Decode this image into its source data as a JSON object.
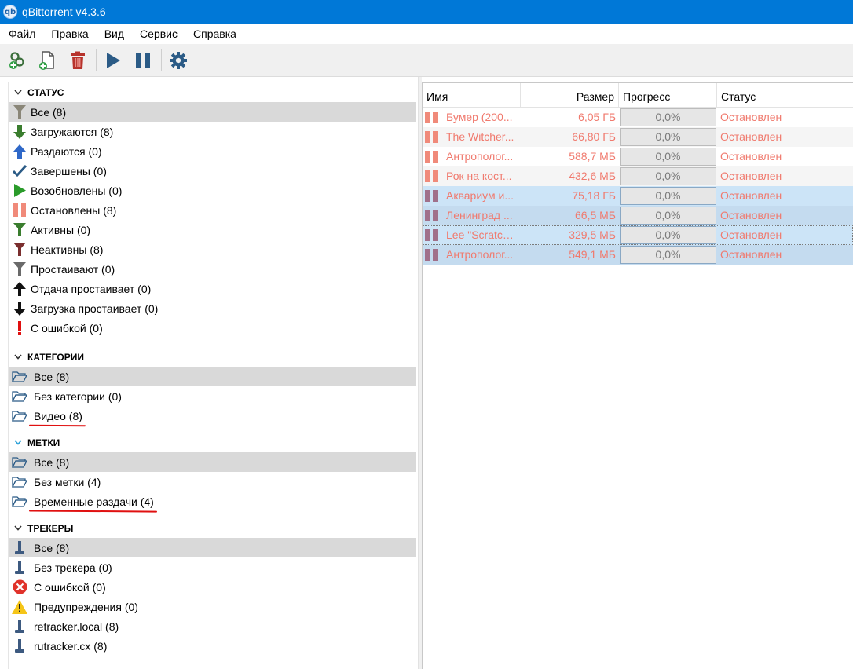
{
  "window": {
    "title": "qBittorrent v4.3.6",
    "icon_text": "qb"
  },
  "menu": [
    "Файл",
    "Правка",
    "Вид",
    "Сервис",
    "Справка"
  ],
  "toolbar": [
    "add-link-icon",
    "add-file-icon",
    "delete-icon",
    "resume-icon",
    "pause-icon",
    "settings-icon"
  ],
  "colors": {
    "titlebar": "#0078d7",
    "paused_text": "#f07a6e",
    "selected_row": "#cce4f7"
  },
  "sidebar": {
    "status": {
      "header": "СТАТУС",
      "items": [
        {
          "label": "Все (8)",
          "icon": "filter-icon"
        },
        {
          "label": "Загружаются (8)",
          "icon": "download-arrow-icon"
        },
        {
          "label": "Раздаются (0)",
          "icon": "upload-arrow-icon"
        },
        {
          "label": "Завершены (0)",
          "icon": "checkmark-icon"
        },
        {
          "label": "Возобновлены (0)",
          "icon": "play-icon"
        },
        {
          "label": "Остановлены (8)",
          "icon": "pause-icon"
        },
        {
          "label": "Активны (0)",
          "icon": "filter-green-icon"
        },
        {
          "label": "Неактивны (8)",
          "icon": "filter-red-icon"
        },
        {
          "label": "Простаивают (0)",
          "icon": "filter-gray-icon"
        },
        {
          "label": "Отдача простаивает (0)",
          "icon": "stalled-upload-icon"
        },
        {
          "label": "Загрузка простаивает (0)",
          "icon": "stalled-download-icon"
        },
        {
          "label": "С ошибкой (0)",
          "icon": "error-exclamation-icon"
        }
      ]
    },
    "categories": {
      "header": "КАТЕГОРИИ",
      "items": [
        {
          "label": "Все (8)"
        },
        {
          "label": "Без категории (0)"
        },
        {
          "label": "Видео (8)"
        }
      ]
    },
    "tags": {
      "header": "МЕТКИ",
      "items": [
        {
          "label": "Все (8)"
        },
        {
          "label": "Без метки (4)"
        },
        {
          "label": "Временные раздачи (4)"
        }
      ]
    },
    "trackers": {
      "header": "ТРЕКЕРЫ",
      "items": [
        {
          "label": "Все (8)",
          "icon": "tracker-icon"
        },
        {
          "label": "Без трекера (0)",
          "icon": "tracker-icon"
        },
        {
          "label": "С ошибкой (0)",
          "icon": "error-circle-icon"
        },
        {
          "label": "Предупреждения (0)",
          "icon": "warning-icon"
        },
        {
          "label": "retracker.local (8)",
          "icon": "tracker-icon"
        },
        {
          "label": "rutracker.cx (8)",
          "icon": "tracker-icon"
        }
      ]
    }
  },
  "torrents": {
    "columns": [
      "Имя",
      "Размер",
      "Прогресс",
      "Статус"
    ],
    "rows": [
      {
        "name": "Бумер (200...",
        "size": "6,05 ГБ",
        "progress": "0,0%",
        "status": "Остановлен"
      },
      {
        "name": "The Witcher...",
        "size": "66,80 ГБ",
        "progress": "0,0%",
        "status": "Остановлен"
      },
      {
        "name": "Антрополог...",
        "size": "588,7 МБ",
        "progress": "0,0%",
        "status": "Остановлен"
      },
      {
        "name": "Рок на кост...",
        "size": "432,6 МБ",
        "progress": "0,0%",
        "status": "Остановлен"
      },
      {
        "name": "Аквариум и...",
        "size": "75,18 ГБ",
        "progress": "0,0%",
        "status": "Остановлен"
      },
      {
        "name": "Ленинград ...",
        "size": "66,5 МБ",
        "progress": "0,0%",
        "status": "Остановлен"
      },
      {
        "name": "Lee \"Scratch...",
        "size": "329,5 МБ",
        "progress": "0,0%",
        "status": "Остановлен"
      },
      {
        "name": "Антрополог...",
        "size": "549,1 МБ",
        "progress": "0,0%",
        "status": "Остановлен"
      }
    ]
  }
}
